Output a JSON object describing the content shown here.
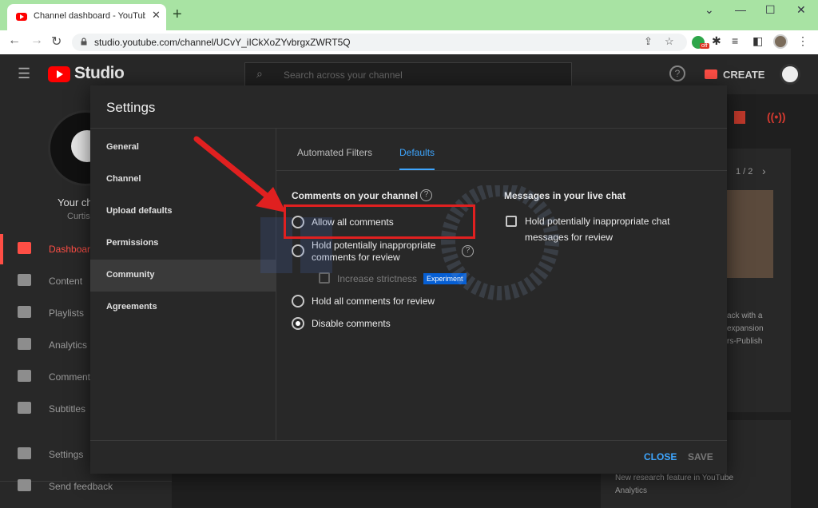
{
  "browser": {
    "tab_title": "Channel dashboard - YouTube Studio",
    "tab_close": "✕",
    "new_tab": "+",
    "url": "studio.youtube.com/channel/UCvY_iICkXoZYvbrgxZWRT5Q",
    "ext_badge": "off",
    "window_controls": [
      "⌄",
      "—",
      "☐",
      "✕"
    ]
  },
  "studio": {
    "brand": "Studio",
    "search_placeholder": "Search across your channel",
    "create_label": "CREATE",
    "help_glyph": "?",
    "channel_name": "Your ch",
    "channel_sub": "Curtis",
    "nav": [
      {
        "label": "Dashboard",
        "icon": "dashboard-icon",
        "active": true
      },
      {
        "label": "Content",
        "icon": "content-icon"
      },
      {
        "label": "Playlists",
        "icon": "playlists-icon"
      },
      {
        "label": "Analytics",
        "icon": "analytics-icon"
      },
      {
        "label": "Comments",
        "icon": "comments-icon"
      },
      {
        "label": "Subtitles",
        "icon": "subtitles-icon"
      },
      {
        "label": "Settings",
        "icon": "gear-icon"
      },
      {
        "label": "Send feedback",
        "icon": "feedback-icon"
      }
    ],
    "background_card": {
      "counter": "1 / 2",
      "snippet_lines": [
        "ack with a",
        "expansion",
        "rs-Publish"
      ],
      "bottom_lines": [
        "New research feature in YouTube",
        "Analytics"
      ]
    }
  },
  "settings_modal": {
    "title": "Settings",
    "sidebar": [
      "General",
      "Channel",
      "Upload defaults",
      "Permissions",
      "Community",
      "Agreements"
    ],
    "active_sidebar": "Community",
    "tabs": [
      {
        "label": "Automated Filters",
        "active": false
      },
      {
        "label": "Defaults",
        "active": true
      }
    ],
    "comments_section": {
      "heading": "Comments on your channel",
      "options": [
        {
          "label": "Allow all comments",
          "selected": false
        },
        {
          "label_line1": "Hold potentially inappropriate",
          "label_line2": "comments for review",
          "selected": false
        },
        {
          "label": "Hold all comments for review",
          "selected": false
        },
        {
          "label": "Disable comments",
          "selected": true
        }
      ],
      "strictness_label": "Increase strictness",
      "strictness_badge": "Experiment"
    },
    "live_chat_section": {
      "heading": "Messages in your live chat",
      "option_line1": "Hold potentially inappropriate chat",
      "option_line2": "messages for review"
    },
    "buttons": {
      "close": "CLOSE",
      "save": "SAVE"
    }
  },
  "colors": {
    "accent_blue": "#3ea6ff",
    "youtube_red": "#ff0000",
    "annotation_red": "#e02020",
    "modal_bg": "#282828"
  }
}
